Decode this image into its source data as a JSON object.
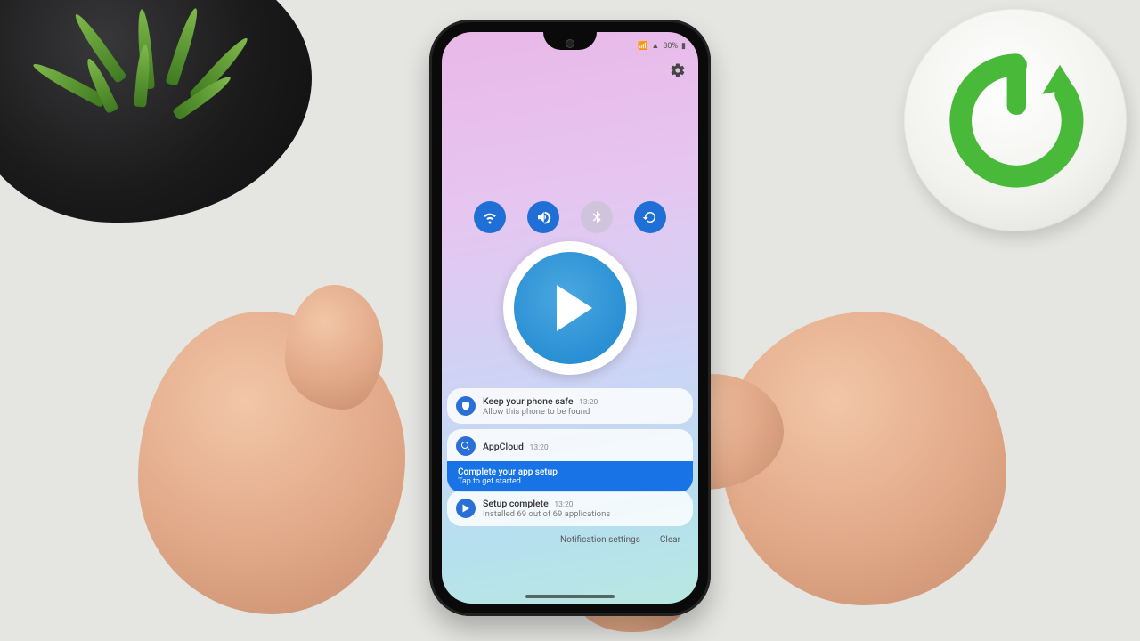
{
  "status": {
    "battery_text": "80%",
    "signal_icon": "📶"
  },
  "quick_settings": [
    {
      "name": "wifi",
      "on": true
    },
    {
      "name": "sound",
      "on": true
    },
    {
      "name": "bluetooth",
      "on": false
    },
    {
      "name": "rotate",
      "on": true
    }
  ],
  "notifications": [
    {
      "app": "Security",
      "title": "Keep your phone safe",
      "time": "13:20",
      "sub": "Allow this phone to be found"
    },
    {
      "app": "AppCloud",
      "title": "AppCloud",
      "time": "13:20",
      "banner_title": "Complete your app setup",
      "banner_sub": "Tap to get started"
    },
    {
      "app": "Setup",
      "title": "Setup complete",
      "time": "13:20",
      "sub": "Installed 69 out of 69 applications"
    }
  ],
  "actions": {
    "settings_label": "Notification settings",
    "clear_label": "Clear"
  }
}
